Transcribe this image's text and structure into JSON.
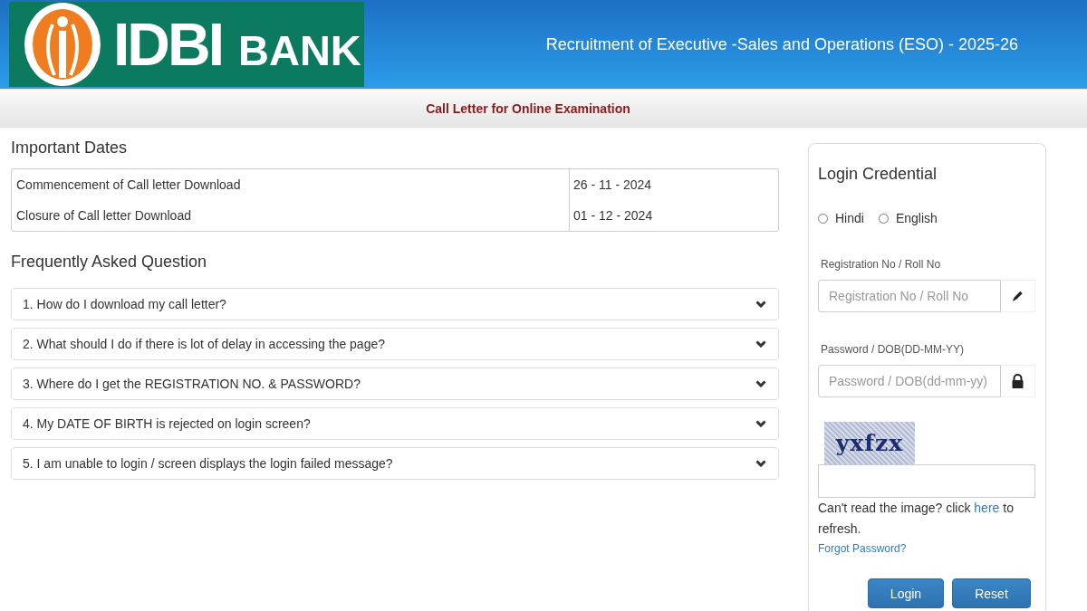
{
  "header": {
    "logo": {
      "primary": "IDBI",
      "secondary": "BANK"
    },
    "title": "Recruitment of Executive -Sales and Operations (ESO) - 2025-26"
  },
  "subheader": {
    "title": "Call Letter for Online Examination"
  },
  "important_dates": {
    "heading": "Important Dates",
    "rows": [
      {
        "event": "Commencement of Call letter Download",
        "date": "26 - 11 - 2024"
      },
      {
        "event": "Closure of Call letter Download",
        "date": "01 - 12 - 2024"
      }
    ]
  },
  "faq": {
    "heading": "Frequently Asked Question",
    "items": [
      {
        "question": "1. How do I download my call letter?",
        "expanded": false
      },
      {
        "question": "2. What should I do if there is lot of delay in accessing the page?",
        "expanded": false
      },
      {
        "question": "3. Where do I get the REGISTRATION NO. & PASSWORD?",
        "expanded": false
      },
      {
        "question": "4. My DATE OF BIRTH is rejected on login screen?",
        "expanded": false
      },
      {
        "question": "5. I am unable to login / screen displays the login failed message?",
        "expanded": false
      }
    ]
  },
  "login": {
    "heading": "Login Credential",
    "languages": [
      {
        "label": "Hindi",
        "selected": false
      },
      {
        "label": "English",
        "selected": false
      }
    ],
    "fields": [
      {
        "kind": "text",
        "label": "Registration No / Roll No",
        "placeholder": "Registration No / Roll No"
      },
      {
        "kind": "password",
        "label": "Password / DOB(DD-MM-YY)",
        "placeholder": "Password / DOB(dd-mm-yy)"
      }
    ],
    "captcha": {
      "text": "yxfzx"
    },
    "captcha_hint": {
      "before": "Can't read the image? click",
      "link": "here",
      "after": "to refresh."
    },
    "forgot_password": "Forgot Password?",
    "buttons": [
      "Login",
      "Reset"
    ]
  }
}
